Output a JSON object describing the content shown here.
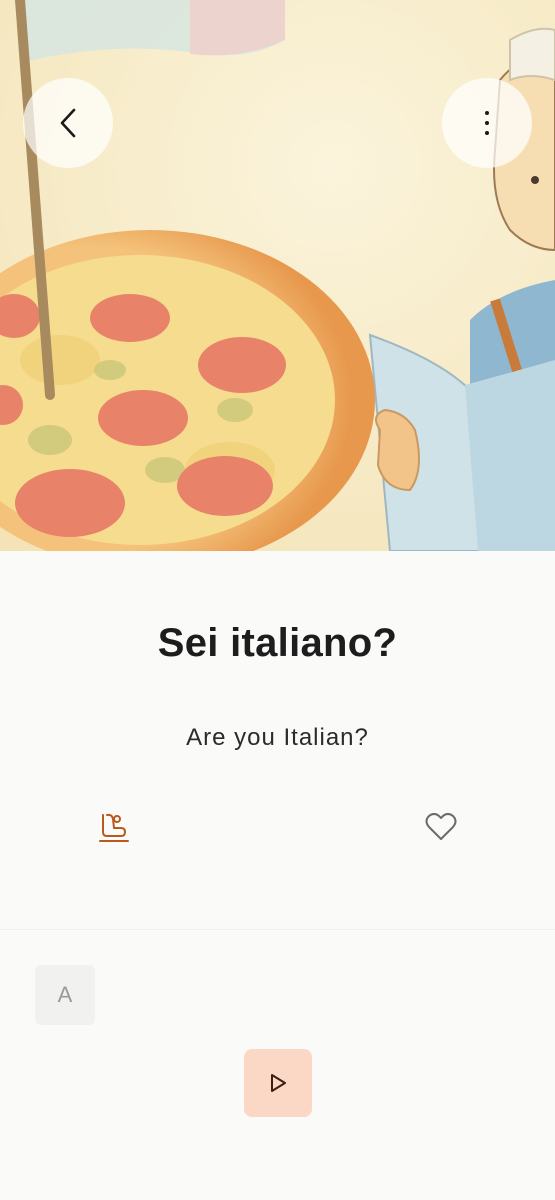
{
  "header": {
    "back_icon": "chevron-left-icon",
    "menu_icon": "more-vertical-icon"
  },
  "illustration": {
    "description_icon": "pizza-illustration"
  },
  "card": {
    "title": "Sei italiano?",
    "translation": "Are you Italian?"
  },
  "actions": {
    "practice_icon": "practice-icon",
    "favorite_icon": "heart-outline-icon",
    "accent_color": "#b85a1e"
  },
  "bottom": {
    "letter_button": "A",
    "play_icon": "play-icon",
    "play_bg": "#fbd7c6"
  }
}
